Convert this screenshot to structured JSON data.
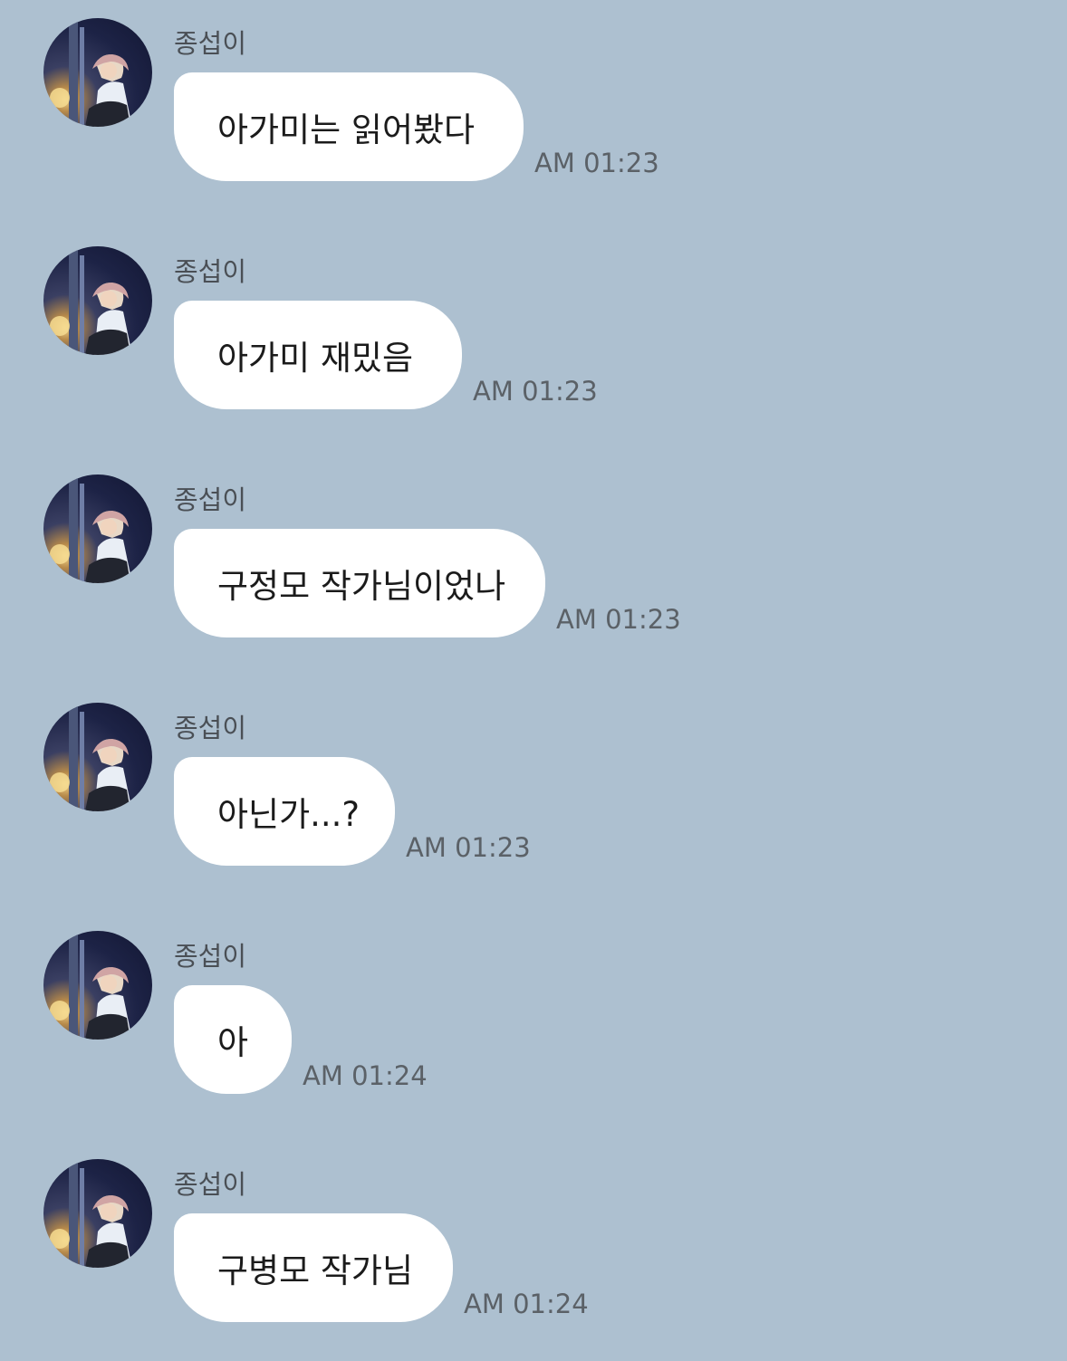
{
  "chat": {
    "messages": [
      {
        "sender": "종섭이",
        "text": "아가미는 읽어봤다",
        "time": "AM 01:23"
      },
      {
        "sender": "종섭이",
        "text": "아가미 재밌음",
        "time": "AM 01:23"
      },
      {
        "sender": "종섭이",
        "text": "구정모 작가님이었나",
        "time": "AM 01:23"
      },
      {
        "sender": "종섭이",
        "text": "아닌가...?",
        "time": "AM 01:23"
      },
      {
        "sender": "종섭이",
        "text": "아",
        "time": "AM 01:24"
      },
      {
        "sender": "종섭이",
        "text": "구병모 작가님",
        "time": "AM 01:24"
      }
    ]
  },
  "colors": {
    "background": "#adc0d0",
    "bubble": "#ffffff"
  },
  "icons": {
    "avatar": "profile-photo"
  }
}
